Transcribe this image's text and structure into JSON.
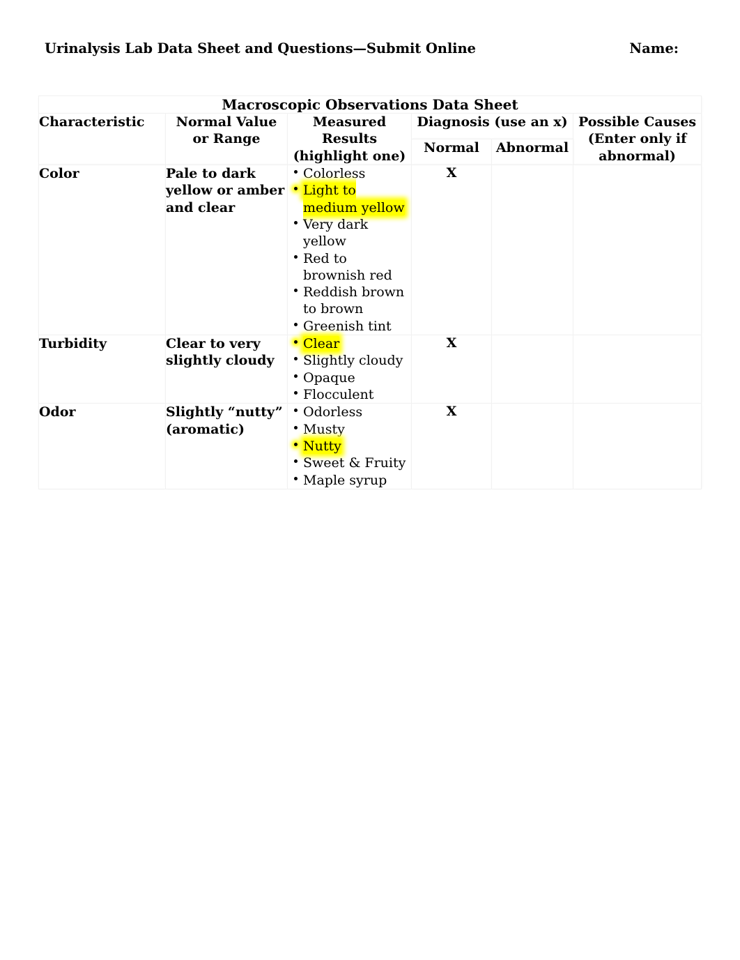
{
  "header": {
    "doc_title": "Urinalysis Lab Data Sheet and Questions—Submit Online",
    "name_label": "Name:"
  },
  "table": {
    "caption": "Macroscopic Observations Data Sheet",
    "headers": {
      "characteristic": "Characteristic",
      "normal_value": "Normal Value or Range",
      "measured_results": "Measured Results (highlight one)",
      "diagnosis": "Diagnosis (use an x)",
      "diagnosis_normal": "Normal",
      "diagnosis_abnormal": "Abnormal",
      "possible_causes": "Possible Causes (Enter only if abnormal)"
    },
    "rows": [
      {
        "characteristic": "Color",
        "normal_value": "Pale to dark yellow or amber and clear",
        "options": [
          {
            "text": "Colorless",
            "highlighted": false
          },
          {
            "text": "Light to medium yellow",
            "highlighted": true
          },
          {
            "text": "Very dark yellow",
            "highlighted": false
          },
          {
            "text": "Red to brownish red",
            "highlighted": false
          },
          {
            "text": "Reddish brown to brown",
            "highlighted": false
          },
          {
            "text": "Greenish tint",
            "highlighted": false
          }
        ],
        "diagnosis_normal": "X",
        "diagnosis_abnormal": "",
        "possible_causes": ""
      },
      {
        "characteristic": "Turbidity",
        "normal_value": "Clear to very slightly cloudy",
        "options": [
          {
            "text": "Clear",
            "highlighted": true
          },
          {
            "text": "Slightly cloudy",
            "highlighted": false
          },
          {
            "text": "Opaque",
            "highlighted": false
          },
          {
            "text": "Flocculent",
            "highlighted": false
          }
        ],
        "diagnosis_normal": "X",
        "diagnosis_abnormal": "",
        "possible_causes": ""
      },
      {
        "characteristic": "Odor",
        "normal_value": "Slightly “nutty” (aromatic)",
        "options": [
          {
            "text": "Odorless",
            "highlighted": false
          },
          {
            "text": "Musty",
            "highlighted": false
          },
          {
            "text": "Nutty",
            "highlighted": true
          },
          {
            "text": "Sweet & Fruity",
            "highlighted": false
          },
          {
            "text": "Maple syrup",
            "highlighted": false
          }
        ],
        "diagnosis_normal": "X",
        "diagnosis_abnormal": "",
        "possible_causes": ""
      }
    ]
  },
  "colors": {
    "highlight": "#ffff00",
    "text": "#000000",
    "border": "#f1f1f1",
    "page_background": "#ffffff"
  }
}
